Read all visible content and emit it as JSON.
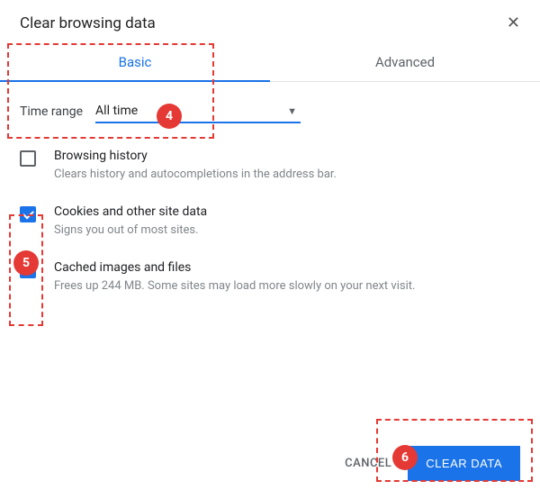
{
  "title": "Clear browsing data",
  "tabs": {
    "basic": "Basic",
    "advanced": "Advanced"
  },
  "time_range": {
    "label": "Time range",
    "value": "All time"
  },
  "options": {
    "history": {
      "title": "Browsing history",
      "desc": "Clears history and autocompletions in the address bar."
    },
    "cookies": {
      "title": "Cookies and other site data",
      "desc": "Signs you out of most sites."
    },
    "cache": {
      "title": "Cached images and files",
      "desc": "Frees up 244 MB. Some sites may load more slowly on your next visit."
    }
  },
  "buttons": {
    "cancel": "CANCEL",
    "clear": "CLEAR DATA"
  },
  "annotations": {
    "four": "4",
    "five": "5",
    "six": "6"
  }
}
